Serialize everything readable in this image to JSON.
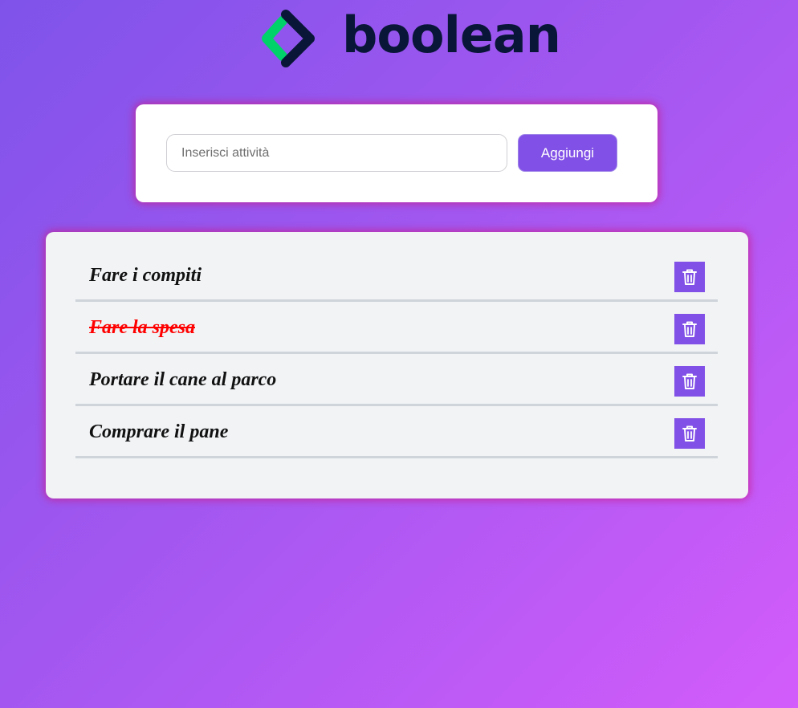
{
  "brand": {
    "name": "boolean",
    "colors": {
      "mark_green": "#00d26a",
      "mark_navy": "#0a1638",
      "accent": "#8150e6"
    }
  },
  "form": {
    "input_placeholder": "Inserisci attività",
    "input_value": "",
    "add_button_label": "Aggiungi"
  },
  "todos": [
    {
      "text": "Fare i compiti",
      "done": false
    },
    {
      "text": "Fare la spesa",
      "done": true
    },
    {
      "text": "Portare il cane al parco",
      "done": false
    },
    {
      "text": "Comprare il pane",
      "done": false
    }
  ],
  "icons": {
    "delete": "trash-icon"
  }
}
